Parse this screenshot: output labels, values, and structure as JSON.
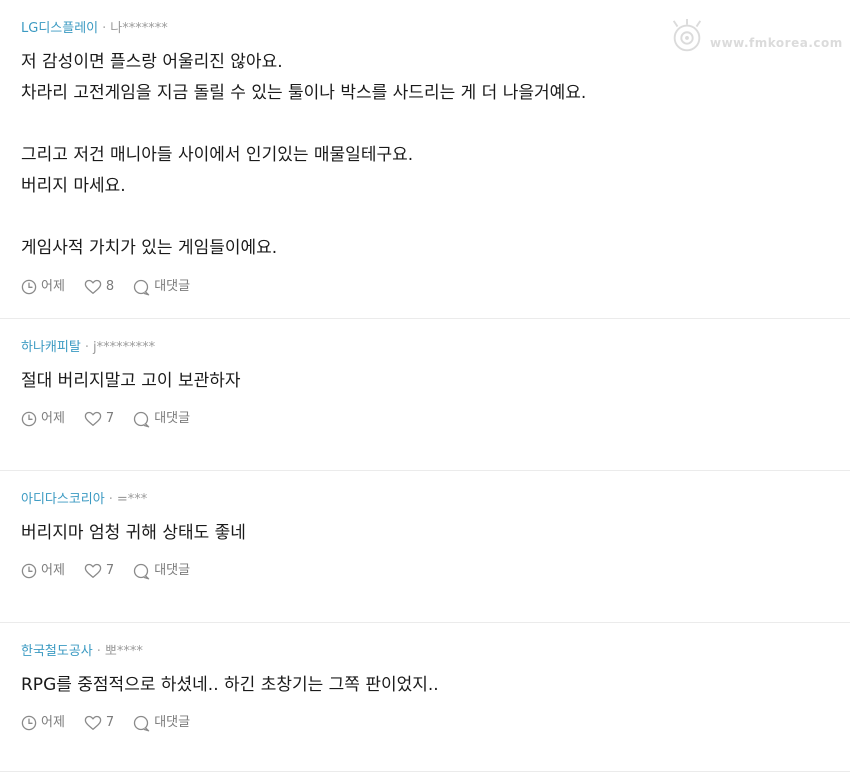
{
  "watermark": {
    "text": "www.fmkorea.com"
  },
  "comments": [
    {
      "company": "LG디스플레이",
      "separator": "·",
      "user": "나*******",
      "lines": [
        "저 감성이면 플스랑 어울리진 않아요.",
        "차라리 고전게임을 지금 돌릴 수 있는 툴이나 박스를 사드리는 게 더 나을거예요.",
        "",
        "그리고 저건 매니아들 사이에서 인기있는 매물일테구요.",
        "버리지 마세요.",
        "",
        "게임사적 가치가 있는 게임들이에요."
      ],
      "time": "어제",
      "likes": "8",
      "reply_label": "대댓글"
    },
    {
      "company": "하나캐피탈",
      "separator": "·",
      "user": "j*********",
      "lines": [
        "절대 버리지말고 고이 보관하자"
      ],
      "time": "어제",
      "likes": "7",
      "reply_label": "대댓글"
    },
    {
      "company": "아디다스코리아",
      "separator": "·",
      "user": "=***",
      "lines": [
        "버리지마 엄청 귀해 상태도 좋네"
      ],
      "time": "어제",
      "likes": "7",
      "reply_label": "대댓글"
    },
    {
      "company": "한국철도공사",
      "separator": "·",
      "user": "뽀****",
      "lines": [
        "RPG를 중점적으로 하셨네.. 하긴 초창기는 그쪽 판이었지.."
      ],
      "time": "어제",
      "likes": "7",
      "reply_label": "대댓글"
    }
  ]
}
